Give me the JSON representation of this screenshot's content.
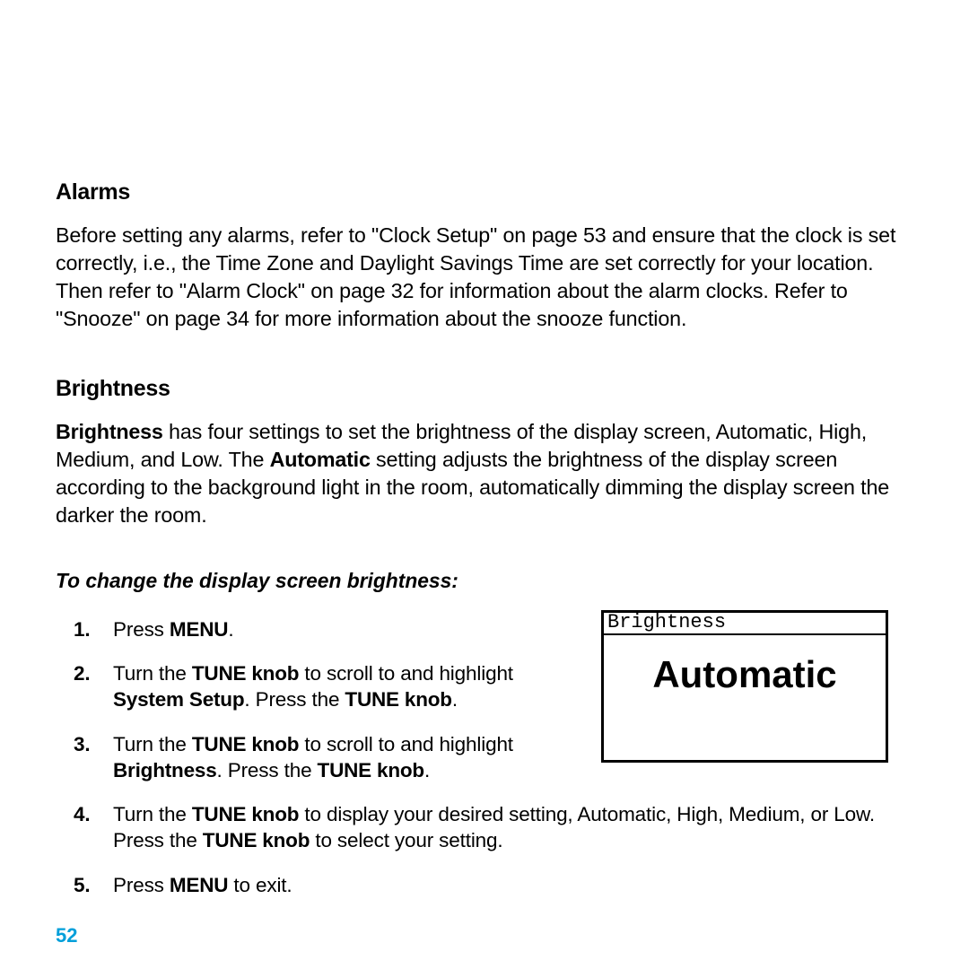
{
  "page_number": "52",
  "sections": {
    "alarms": {
      "heading": "Alarms",
      "body_parts": [
        "Before setting any alarms, refer to \"Clock Setup\" on page 53 and ensure that the clock is set correctly, i.e., the Time Zone and Daylight Savings Time are set correctly for your location. Then refer to \"Alarm Clock\" on page 32 for information about the alarm clocks. Refer to \"Snooze\" on page 34 for more information about the snooze function."
      ]
    },
    "brightness": {
      "heading": "Brightness",
      "intro_segments": [
        {
          "t": "Brightness",
          "b": true
        },
        {
          "t": " has four settings to set the brightness of the display screen, Automatic, High, Medium, and Low. The "
        },
        {
          "t": "Automatic",
          "b": true
        },
        {
          "t": " setting adjusts the brightness of the display screen according to the background light in the room, automatically dimming the display screen the darker the room."
        }
      ],
      "subhead": "To change the display screen brightness:",
      "steps": [
        [
          {
            "t": "Press "
          },
          {
            "t": "MENU",
            "b": true
          },
          {
            "t": "."
          }
        ],
        [
          {
            "t": "Turn the "
          },
          {
            "t": "TUNE knob",
            "b": true
          },
          {
            "t": " to scroll to and highlight "
          },
          {
            "t": "System Setup",
            "b": true
          },
          {
            "t": ". Press the "
          },
          {
            "t": "TUNE knob",
            "b": true
          },
          {
            "t": "."
          }
        ],
        [
          {
            "t": "Turn the "
          },
          {
            "t": "TUNE knob",
            "b": true
          },
          {
            "t": " to scroll to and highlight "
          },
          {
            "t": "Brightness",
            "b": true
          },
          {
            "t": ". Press the "
          },
          {
            "t": "TUNE knob",
            "b": true
          },
          {
            "t": "."
          }
        ],
        [
          {
            "t": "Turn the "
          },
          {
            "t": "TUNE knob",
            "b": true
          },
          {
            "t": " to display your desired setting, Automatic, High, Medium, or Low. Press the "
          },
          {
            "t": "TUNE knob",
            "b": true
          },
          {
            "t": " to select your setting."
          }
        ],
        [
          {
            "t": "Press "
          },
          {
            "t": "MENU",
            "b": true
          },
          {
            "t": " to exit."
          }
        ]
      ],
      "illustration": {
        "title": "Brightness",
        "value": "Automatic"
      }
    }
  }
}
